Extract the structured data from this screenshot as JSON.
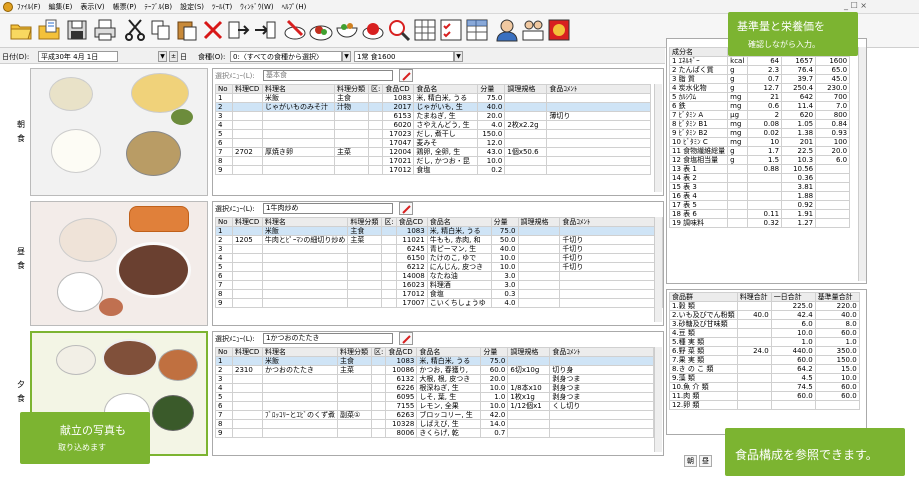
{
  "menu": [
    "ﾌｧｲﾙ(F)",
    "編集(E)",
    "表示(V)",
    "帳票(P)",
    "ﾃｰﾌﾞﾙ(B)",
    "設定(S)",
    "ﾂｰﾙ(T)",
    "ｳｨﾝﾄﾞｳ(W)",
    "ﾍﾙﾌﾟ(H)"
  ],
  "window_controls": "_ ☐ ×",
  "toolbar_icons": [
    "open-folder-icon",
    "open-file-icon",
    "save-icon",
    "print-icon",
    "cut-icon",
    "copy-icon",
    "paste-icon",
    "delete-icon",
    "arrow-right-icon",
    "arrow-import-icon",
    "pencil-food-icon",
    "dish-icon",
    "bowl-icon",
    "apple-icon",
    "search-icon",
    "grid-icon",
    "checklist-icon",
    "table-icon",
    "person-icon",
    "people-icon",
    "display-icon"
  ],
  "datebar": {
    "date_label": "日付(D):",
    "date_value": "平成30年 4月 1日",
    "day_label": "日",
    "type_label": "食種(O):",
    "type_value": "0:〈すべての食種から選択〉",
    "menu_value": "1常 食1600"
  },
  "meals": [
    {
      "label": "朝\n食"
    },
    {
      "label": "昼\n食"
    },
    {
      "label": "夕\n食"
    }
  ],
  "columns": [
    "No",
    "料理CD",
    "料理名",
    "料理分類",
    "区:",
    "食品CD",
    "食品名",
    "分量",
    "調理規格",
    "食品ｺﾒﾝﾄ"
  ],
  "panels": [
    {
      "select_label": "選択ﾒﾆｭｰ(L):",
      "select_value": "基本食",
      "rows": [
        [
          "1",
          "",
          "米飯",
          "主食",
          "",
          "1083",
          "米, 精白米, うる",
          "75.0",
          "",
          ""
        ],
        [
          "2",
          "",
          "じゃがいものみそ汁",
          "汁物",
          "",
          "2017",
          "じゃがいも, 生",
          "40.0",
          "",
          ""
        ],
        [
          "3",
          "",
          "",
          "",
          "",
          "6153",
          "たまねぎ, 生",
          "20.0",
          "",
          "薄切り"
        ],
        [
          "4",
          "",
          "",
          "",
          "",
          "6020",
          "さやえんどう, 生",
          "4.0",
          "2枚x2.2g",
          ""
        ],
        [
          "5",
          "",
          "",
          "",
          "",
          "17023",
          "だし, 煮干し",
          "150.0",
          "",
          ""
        ],
        [
          "6",
          "",
          "",
          "",
          "",
          "17047",
          "麦みそ",
          "12.0",
          "",
          ""
        ],
        [
          "7",
          "2702",
          "厚焼き卵",
          "主菜",
          "",
          "12004",
          "鶏卵, 全卵, 生",
          "43.0",
          "1個x50.6",
          ""
        ],
        [
          "8",
          "",
          "",
          "",
          "",
          "17021",
          "だし, かつお・昆",
          "10.0",
          "",
          ""
        ],
        [
          "9",
          "",
          "",
          "",
          "",
          "17012",
          "食塩",
          "0.2",
          "",
          ""
        ]
      ]
    },
    {
      "select_label": "選択ﾒﾆｭｰ(L):",
      "select_value": "1牛肉炒め",
      "rows": [
        [
          "1",
          "",
          "米飯",
          "主食",
          "",
          "1083",
          "米, 精白米, うる",
          "75.0",
          "",
          ""
        ],
        [
          "2",
          "1205",
          "牛肉とﾋﾟｰﾏﾝの細切り炒め",
          "主菜",
          "",
          "11021",
          "牛もも, 赤肉, 和",
          "50.0",
          "",
          "千切り"
        ],
        [
          "3",
          "",
          "",
          "",
          "",
          "6245",
          "青ピーマン, 生",
          "40.0",
          "",
          "千切り"
        ],
        [
          "4",
          "",
          "",
          "",
          "",
          "6150",
          "たけのこ, ゆで",
          "10.0",
          "",
          "千切り"
        ],
        [
          "5",
          "",
          "",
          "",
          "",
          "6212",
          "にんじん, 皮つき",
          "10.0",
          "",
          "千切り"
        ],
        [
          "6",
          "",
          "",
          "",
          "",
          "14008",
          "なたね油",
          "3.0",
          "",
          ""
        ],
        [
          "7",
          "",
          "",
          "",
          "",
          "16023",
          "料理酒",
          "3.0",
          "",
          ""
        ],
        [
          "8",
          "",
          "",
          "",
          "",
          "17012",
          "食塩",
          "0.3",
          "",
          ""
        ],
        [
          "9",
          "",
          "",
          "",
          "",
          "17007",
          "こいくちしょうゆ",
          "4.0",
          "",
          ""
        ]
      ]
    },
    {
      "select_label": "選択ﾒﾆｭｰ(L):",
      "select_value": "1かつおのたたき",
      "rows": [
        [
          "1",
          "",
          "米飯",
          "主食",
          "",
          "1083",
          "米, 精白米, うる",
          "75.0",
          "",
          ""
        ],
        [
          "2",
          "2310",
          "かつおのたたき",
          "主菜",
          "",
          "10086",
          "かつお, 春獲り,",
          "60.0",
          "6切x10g",
          "切り身"
        ],
        [
          "3",
          "",
          "",
          "",
          "",
          "6132",
          "大根, 根, 皮つき",
          "20.0",
          "",
          "剥身つま"
        ],
        [
          "4",
          "",
          "",
          "",
          "",
          "6226",
          "根深ねぎ, 生",
          "10.0",
          "1/8本x10",
          "剥身つま"
        ],
        [
          "5",
          "",
          "",
          "",
          "",
          "6095",
          "しそ, 葉, 生",
          "1.0",
          "1枚x1g",
          "剥身つま"
        ],
        [
          "6",
          "",
          "",
          "",
          "",
          "7155",
          "レモン, 全果",
          "10.0",
          "1/12個x1",
          "くし切り"
        ],
        [
          "7",
          "",
          "ﾌﾞﾛｯｺﾘｰとｴﾋﾞのくず煮",
          "副菜①",
          "",
          "6263",
          "ブロッコリー, 生",
          "42.0",
          "",
          ""
        ],
        [
          "8",
          "",
          "",
          "",
          "",
          "10328",
          "しばえび, 生",
          "14.0",
          "",
          ""
        ],
        [
          "9",
          "",
          "",
          "",
          "",
          "8006",
          "きくらげ, 乾",
          "0.7",
          "",
          ""
        ]
      ]
    }
  ],
  "nutrition": {
    "headers": [
      "成分名",
      "単位",
      "",
      "",
      ""
    ],
    "rows": [
      [
        "1 ｴﾈﾙｷﾞｰ",
        "kcal",
        "64",
        "1657",
        "1600"
      ],
      [
        "2 たんぱく質",
        "g",
        "2.3",
        "76.4",
        "65.0"
      ],
      [
        "3 脂 質",
        "g",
        "0.7",
        "39.7",
        "45.0"
      ],
      [
        "4 炭水化物",
        "g",
        "12.7",
        "250.4",
        "230.0"
      ],
      [
        "5 ｶﾙｼｳﾑ",
        "mg",
        "21",
        "642",
        "700"
      ],
      [
        "6 鉄",
        "mg",
        "0.6",
        "11.4",
        "7.0"
      ],
      [
        "7 ﾋﾞﾀﾐﾝ A",
        "μg",
        "2",
        "620",
        "800"
      ],
      [
        "8 ﾋﾞﾀﾐﾝ B1",
        "mg",
        "0.08",
        "1.05",
        "0.84"
      ],
      [
        "9 ﾋﾞﾀﾐﾝ B2",
        "mg",
        "0.02",
        "1.38",
        "0.93"
      ],
      [
        "10 ﾋﾞﾀﾐﾝ C",
        "mg",
        "10",
        "201",
        "100"
      ],
      [
        "11 食物繊維総量",
        "g",
        "1.7",
        "22.5",
        "20.0"
      ],
      [
        "12 食塩相当量",
        "g",
        "1.5",
        "10.3",
        "6.0"
      ],
      [
        "13 表 1",
        "",
        "0.88",
        "10.56",
        ""
      ],
      [
        "14 表 2",
        "",
        "",
        "0.36",
        ""
      ],
      [
        "15 表 3",
        "",
        "",
        "3.81",
        ""
      ],
      [
        "16 表 4",
        "",
        "",
        "1.88",
        ""
      ],
      [
        "17 表 5",
        "",
        "",
        "0.92",
        ""
      ],
      [
        "18 表 6",
        "",
        "0.11",
        "1.91",
        ""
      ],
      [
        "19 調味料",
        "",
        "0.32",
        "1.27",
        ""
      ]
    ]
  },
  "food_groups": {
    "headers": [
      "食品群",
      "料理合計",
      "一日合計",
      "基準量合計"
    ],
    "rows": [
      [
        "1.穀",
        "類",
        "",
        "225.0",
        "220.0"
      ],
      [
        "2.いも及びでん粉類",
        "",
        "40.0",
        "42.4",
        "40.0"
      ],
      [
        "3.砂糖及び甘味類",
        "",
        "",
        "6.0",
        "8.0"
      ],
      [
        "4.豆",
        "類",
        "",
        "10.0",
        "60.0"
      ],
      [
        "5.種",
        "実",
        "類",
        "1.0",
        "1.0"
      ],
      [
        "6.野",
        "菜",
        "類",
        "24.0",
        "440.0",
        "350.0"
      ],
      [
        "7.果",
        "実",
        "類",
        "",
        "60.0",
        "150.0"
      ],
      [
        "8.き の こ",
        "類",
        "",
        "64.2",
        "15.0"
      ],
      [
        "9.藻",
        "類",
        "",
        "4.5",
        "10.0"
      ],
      [
        "10.魚",
        "介",
        "類",
        "74.5",
        "60.0"
      ],
      [
        "11.肉",
        "類",
        "",
        "60.0",
        "60.0"
      ],
      [
        "12.卵",
        "類",
        "",
        "",
        ""
      ]
    ]
  },
  "callouts": {
    "top_right_line1": "基準量と栄養価を",
    "top_right_line2": "確認しながら入力。",
    "bottom_right": "食品構成を参照できます。",
    "bottom_left_line1": "献立の写真も",
    "bottom_left_line2": "取り込めます"
  },
  "bottom_tabs": [
    "朝",
    "昼"
  ],
  "colors": {
    "accent": "#7cb431",
    "highlight": "#cfe4f6"
  }
}
